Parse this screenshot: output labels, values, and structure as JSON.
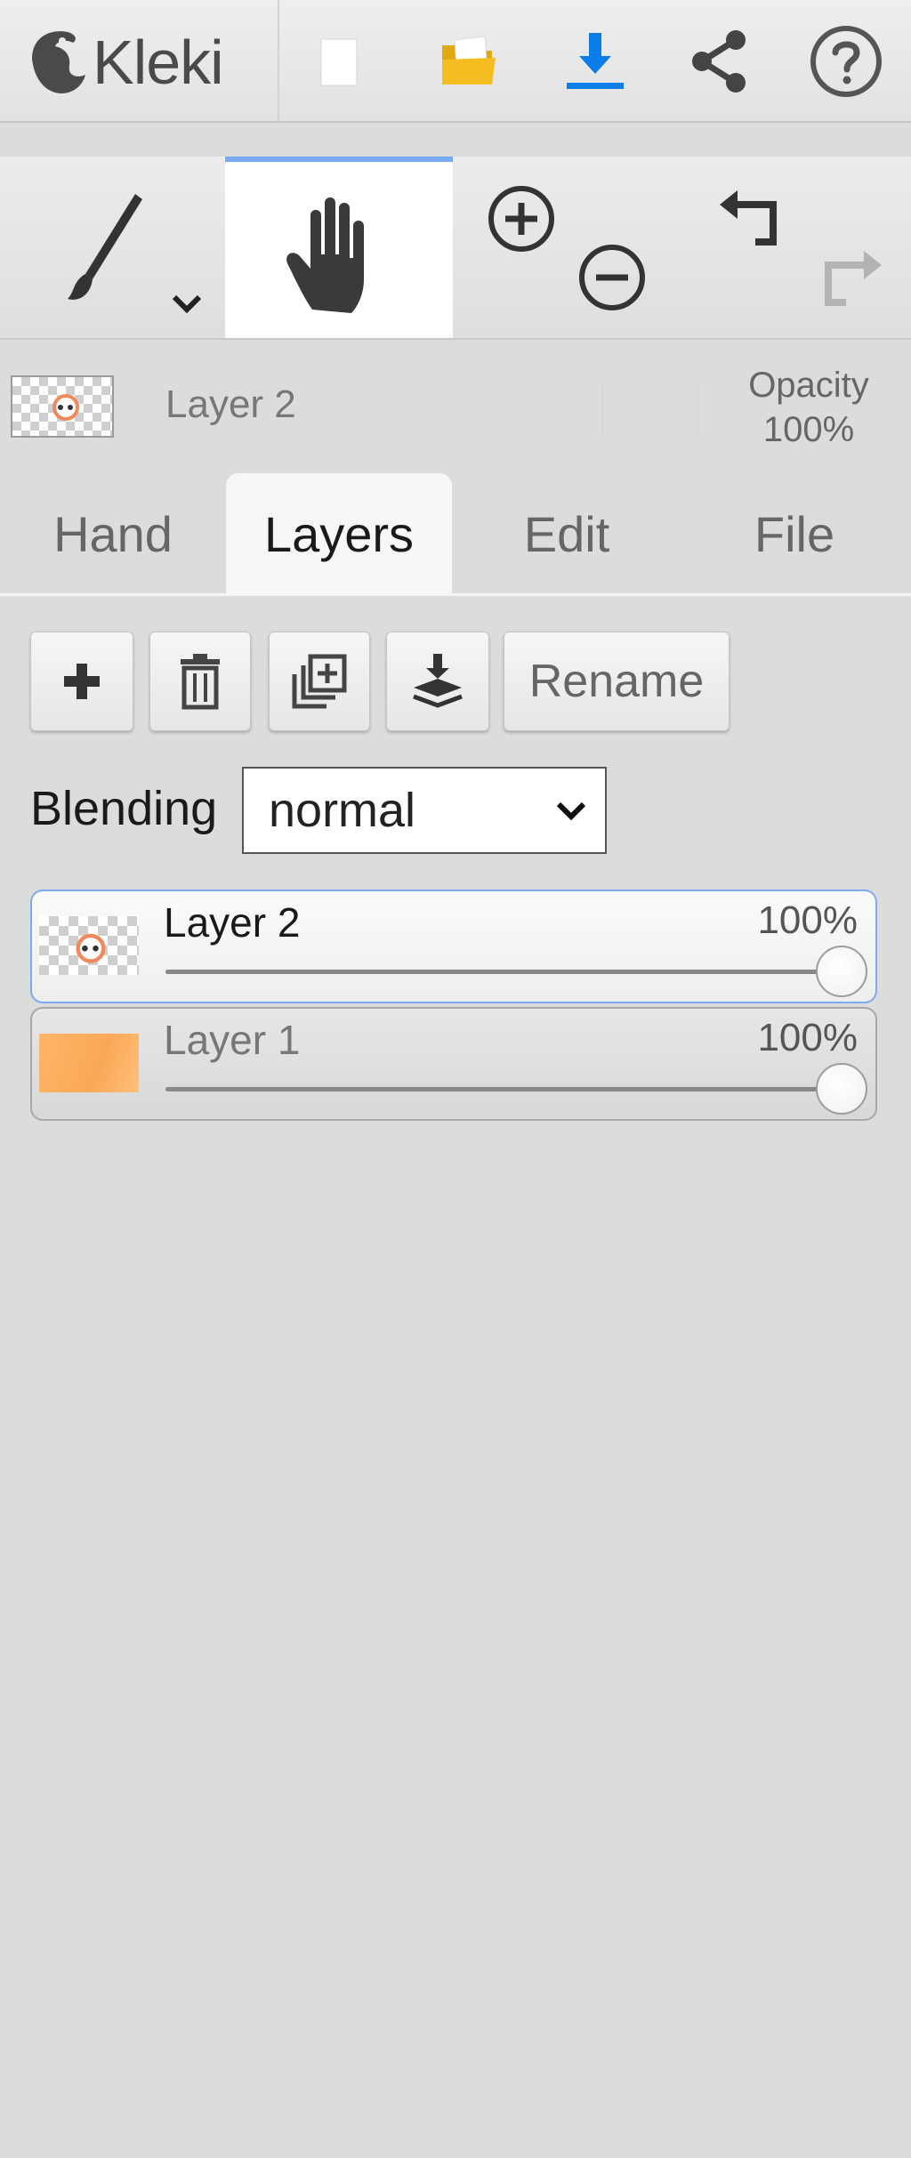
{
  "app": {
    "name": "Kleki"
  },
  "toolbar": {
    "buttons": [
      {
        "name": "new-image",
        "icon": "new-page-icon"
      },
      {
        "name": "open-image",
        "icon": "folder-open-icon"
      },
      {
        "name": "save",
        "icon": "download-icon"
      },
      {
        "name": "share",
        "icon": "share-icon"
      },
      {
        "name": "help",
        "icon": "help-icon"
      }
    ]
  },
  "tools": {
    "items": [
      {
        "name": "brush",
        "icon": "brush-icon",
        "active": false
      },
      {
        "name": "hand",
        "icon": "hand-icon",
        "active": true
      },
      {
        "name": "zoom",
        "icon": "zoom-in-out-icon",
        "active": false
      },
      {
        "name": "undo-redo",
        "icon": "undo-redo-icon",
        "active": false
      }
    ]
  },
  "layer_info": {
    "name": "Layer 2",
    "opacity_label": "Opacity",
    "opacity_value": "100%"
  },
  "tabs": [
    {
      "label": "Hand",
      "active": false
    },
    {
      "label": "Layers",
      "active": true
    },
    {
      "label": "Edit",
      "active": false
    },
    {
      "label": "File",
      "active": false
    }
  ],
  "layers_panel": {
    "actions": {
      "add_icon": "plus-icon",
      "delete_icon": "trash-icon",
      "duplicate_icon": "duplicate-icon",
      "merge_icon": "merge-down-icon",
      "rename_label": "Rename"
    },
    "blending": {
      "label": "Blending",
      "value": "normal"
    },
    "layers": [
      {
        "name": "Layer 2",
        "opacity_label": "100%",
        "opacity": 1.0,
        "selected": true
      },
      {
        "name": "Layer 1",
        "opacity_label": "100%",
        "opacity": 1.0,
        "selected": false
      }
    ]
  },
  "colors": {
    "accent_blue": "#0a7de8",
    "folder_yellow": "#f5bd1f",
    "active_tab_border": "#78a9f2",
    "layer1_thumb": "#ffb567"
  }
}
